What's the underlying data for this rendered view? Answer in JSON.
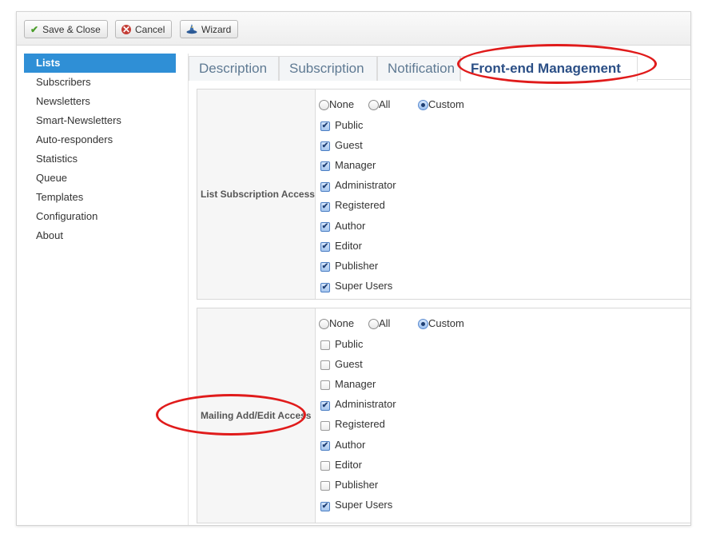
{
  "toolbar": {
    "save_close": "Save & Close",
    "cancel": "Cancel",
    "wizard": "Wizard"
  },
  "sidebar": {
    "items": [
      {
        "label": "Lists",
        "active": true
      },
      {
        "label": "Subscribers",
        "active": false
      },
      {
        "label": "Newsletters",
        "active": false
      },
      {
        "label": "Smart-Newsletters",
        "active": false
      },
      {
        "label": "Auto-responders",
        "active": false
      },
      {
        "label": "Statistics",
        "active": false
      },
      {
        "label": "Queue",
        "active": false
      },
      {
        "label": "Templates",
        "active": false
      },
      {
        "label": "Configuration",
        "active": false
      },
      {
        "label": "About",
        "active": false
      }
    ]
  },
  "tabs": [
    {
      "label": "Description",
      "active": false
    },
    {
      "label": "Subscription",
      "active": false
    },
    {
      "label": "Notification",
      "active": false
    },
    {
      "label": "Front-end Management",
      "active": true
    }
  ],
  "sections": [
    {
      "label": "List Subscription Access",
      "radio": {
        "options": [
          "None",
          "All",
          "Custom"
        ],
        "selected": "Custom"
      },
      "groups": [
        {
          "name": "Public",
          "checked": true
        },
        {
          "name": "Guest",
          "checked": true
        },
        {
          "name": "Manager",
          "checked": true
        },
        {
          "name": "Administrator",
          "checked": true
        },
        {
          "name": "Registered",
          "checked": true
        },
        {
          "name": "Author",
          "checked": true
        },
        {
          "name": "Editor",
          "checked": true
        },
        {
          "name": "Publisher",
          "checked": true
        },
        {
          "name": "Super Users",
          "checked": true
        }
      ]
    },
    {
      "label": "Mailing Add/Edit Access",
      "radio": {
        "options": [
          "None",
          "All",
          "Custom"
        ],
        "selected": "Custom"
      },
      "groups": [
        {
          "name": "Public",
          "checked": false
        },
        {
          "name": "Guest",
          "checked": false
        },
        {
          "name": "Manager",
          "checked": false
        },
        {
          "name": "Administrator",
          "checked": true
        },
        {
          "name": "Registered",
          "checked": false
        },
        {
          "name": "Author",
          "checked": true
        },
        {
          "name": "Editor",
          "checked": false
        },
        {
          "name": "Publisher",
          "checked": false
        },
        {
          "name": "Super Users",
          "checked": true
        }
      ]
    }
  ],
  "colors": {
    "accent": "#2f8fd6",
    "annotation": "#e01b1b",
    "active_tab_text": "#2b4f86"
  },
  "icons": {
    "save_close": "check-icon",
    "cancel": "cancel-circle-icon",
    "wizard": "wizard-hat-icon"
  }
}
